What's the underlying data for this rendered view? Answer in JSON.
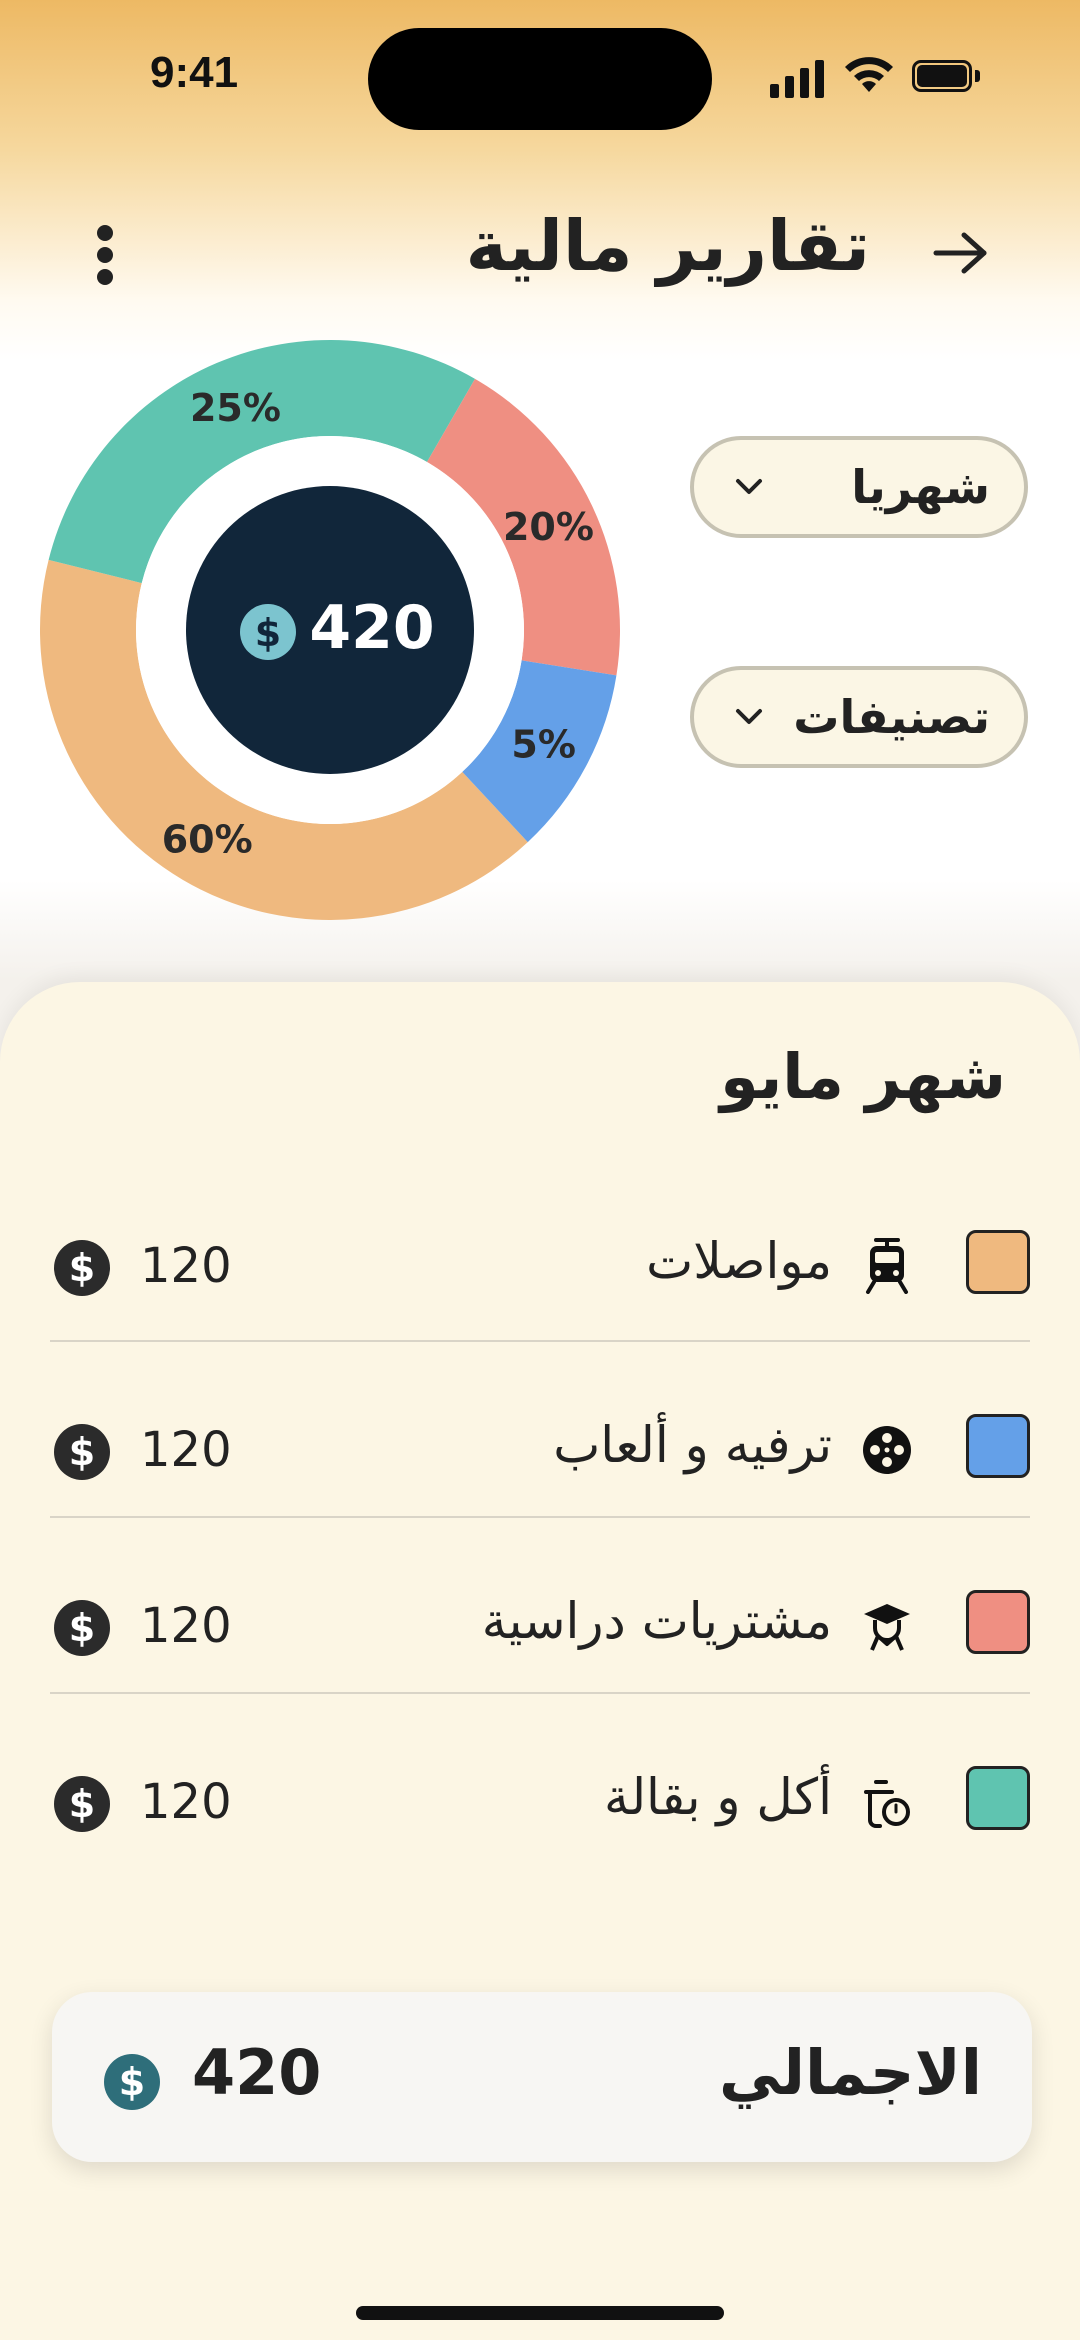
{
  "status_bar": {
    "time": "9:41"
  },
  "header": {
    "title": "تقارير مالية"
  },
  "chart_data": {
    "type": "pie",
    "segments": [
      {
        "label": "مواصلات",
        "value": 60,
        "display": "60%",
        "color": "#efb97f"
      },
      {
        "label": "أكل و بقالة",
        "value": 25,
        "display": "25%",
        "color": "#5fc4b0"
      },
      {
        "label": "مشتريات دراسية",
        "value": 20,
        "display": "20%",
        "color": "#ef8f82"
      },
      {
        "label": "ترفيه و ألعاب",
        "value": 5,
        "display": "5%",
        "color": "#64a0e8"
      }
    ],
    "center_value": "420",
    "center_icon": "dollar-coin-icon"
  },
  "filters": {
    "period": {
      "label": "شهريا"
    },
    "categories": {
      "label": "تصنيفات"
    }
  },
  "sheet": {
    "month_title": "شهر مايو",
    "items": [
      {
        "name": "مواصلات",
        "amount": "120",
        "color": "#efb97f",
        "icon": "tram-icon"
      },
      {
        "name": "ترفيه و ألعاب",
        "amount": "120",
        "color": "#64a0e8",
        "icon": "film-reel-icon"
      },
      {
        "name": "مشتريات دراسية",
        "amount": "120",
        "color": "#ef8f82",
        "icon": "graduate-icon"
      },
      {
        "name": "أكل و بقالة",
        "amount": "120",
        "color": "#5fc4b0",
        "icon": "cooking-pot-icon"
      }
    ],
    "total": {
      "label": "الاجمالي",
      "amount": "420"
    }
  },
  "colors": {
    "coin": "#2e7d8a",
    "coin_light": "#7cc4cf",
    "dark_center": "#11263a"
  }
}
